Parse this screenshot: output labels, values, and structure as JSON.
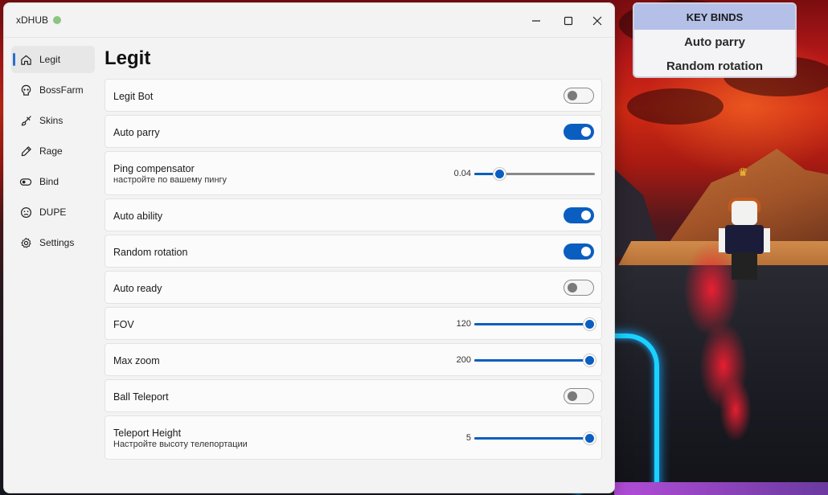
{
  "app": {
    "title": "xDHUB",
    "status_color": "#8cc482"
  },
  "window_controls": [
    "minimize-icon",
    "maximize-icon",
    "close-icon"
  ],
  "sidebar": {
    "items": [
      {
        "label": "Legit",
        "icon": "home-icon",
        "active": true
      },
      {
        "label": "BossFarm",
        "icon": "skull-icon"
      },
      {
        "label": "Skins",
        "icon": "brush-icon"
      },
      {
        "label": "Rage",
        "icon": "pen-icon"
      },
      {
        "label": "Bind",
        "icon": "toggle-icon"
      },
      {
        "label": "DUPE",
        "icon": "sad-face-icon"
      },
      {
        "label": "Settings",
        "icon": "gear-icon"
      }
    ]
  },
  "page": {
    "title": "Legit"
  },
  "settings": {
    "legit_bot": {
      "label": "Legit Bot",
      "enabled": false
    },
    "auto_parry": {
      "label": "Auto parry",
      "enabled": true
    },
    "ping_compensator": {
      "label": "Ping compensator",
      "description": "настройте по вашему пингу",
      "value": "0.04",
      "fraction": 0.18
    },
    "auto_ability": {
      "label": "Auto ability",
      "enabled": true
    },
    "random_rotation": {
      "label": "Random rotation",
      "enabled": true
    },
    "auto_ready": {
      "label": "Auto ready",
      "enabled": false
    },
    "fov": {
      "label": "FOV",
      "value": "120",
      "fraction": 1.0
    },
    "max_zoom": {
      "label": "Max zoom",
      "value": "200",
      "fraction": 1.0
    },
    "ball_teleport": {
      "label": "Ball Teleport",
      "enabled": false
    },
    "teleport_height": {
      "label": "Teleport Height",
      "description": "Настройте высоту телепортации",
      "value": "5",
      "fraction": 1.0
    }
  },
  "keybinds": {
    "header": "KEY BINDS",
    "items": [
      "Auto parry",
      "Random rotation"
    ]
  },
  "colors": {
    "accent": "#0a5ec0",
    "keybind_header": "#b4c0e8"
  }
}
